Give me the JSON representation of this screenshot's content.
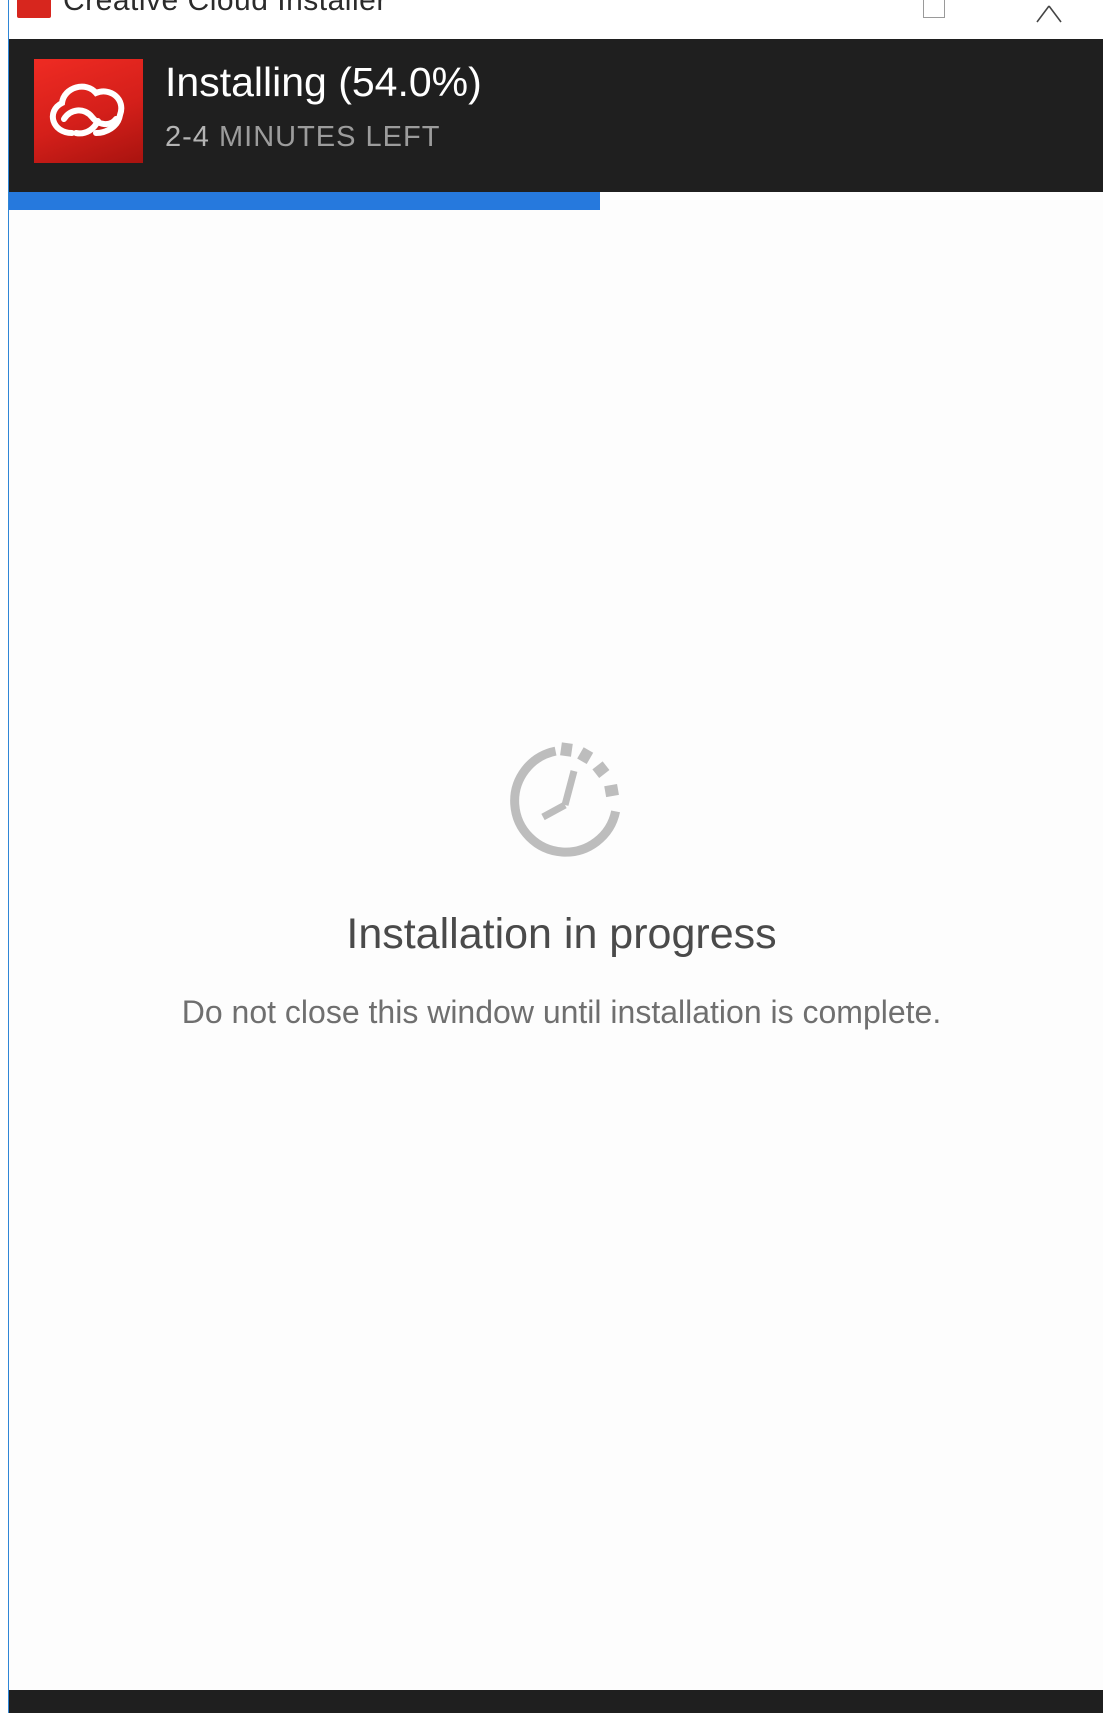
{
  "window": {
    "title": "Creative Cloud Installer"
  },
  "header": {
    "status": "Installing (54.0%)",
    "time_range": "2-4",
    "time_suffix": "MINUTES LEFT"
  },
  "progress": {
    "percent": 54.0,
    "color": "#2679dd"
  },
  "content": {
    "title": "Installation in progress",
    "message": "Do not close this window until installation is complete."
  },
  "icons": {
    "app_logo": "creative-cloud-logo-icon",
    "spinner": "clock-icon",
    "maximize": "maximize-icon",
    "close": "close-icon"
  },
  "colors": {
    "header_bg": "#1f1f1f",
    "brand_red": "#e1251b",
    "progress_blue": "#2679dd"
  }
}
